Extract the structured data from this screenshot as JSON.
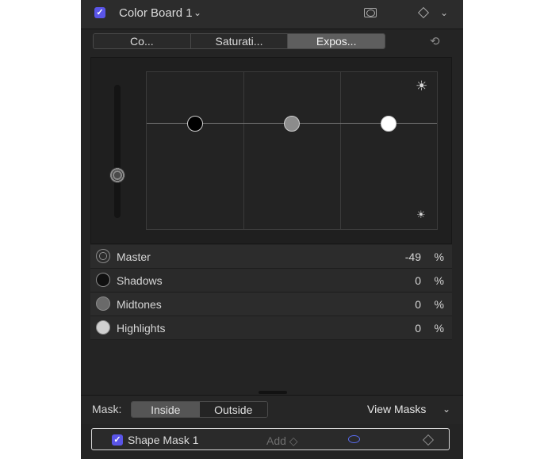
{
  "header": {
    "enabled_check": "✓",
    "title": "Color Board 1",
    "title_chevron": "⌄",
    "menu_chevron": "⌄"
  },
  "tabs": [
    {
      "label": "Co...",
      "active": false
    },
    {
      "label": "Saturati...",
      "active": false
    },
    {
      "label": "Expos...",
      "active": true
    }
  ],
  "reset_icon": "⟲",
  "board": {
    "master_value": -49,
    "pucks": [
      {
        "name": "shadows-puck",
        "color": "#000000"
      },
      {
        "name": "midtones-puck",
        "color": "#8c8c8c"
      },
      {
        "name": "highlights-puck",
        "color": "#ffffff"
      }
    ],
    "bright_icon": "☀",
    "dim_icon": "☀"
  },
  "rows": [
    {
      "label": "Master",
      "value": "-49",
      "unit": "%",
      "icon": "master-ring-icon"
    },
    {
      "label": "Shadows",
      "value": "0",
      "unit": "%",
      "icon": "shadows-icon"
    },
    {
      "label": "Midtones",
      "value": "0",
      "unit": "%",
      "icon": "midtones-icon"
    },
    {
      "label": "Highlights",
      "value": "0",
      "unit": "%",
      "icon": "highlights-icon"
    }
  ],
  "mask_bar": {
    "label": "Mask:",
    "inside": "Inside",
    "outside": "Outside",
    "view_masks": "View Masks",
    "chevron": "⌄"
  },
  "shape_mask": {
    "check": "✓",
    "label": "Shape Mask 1",
    "add": "Add ◇"
  }
}
